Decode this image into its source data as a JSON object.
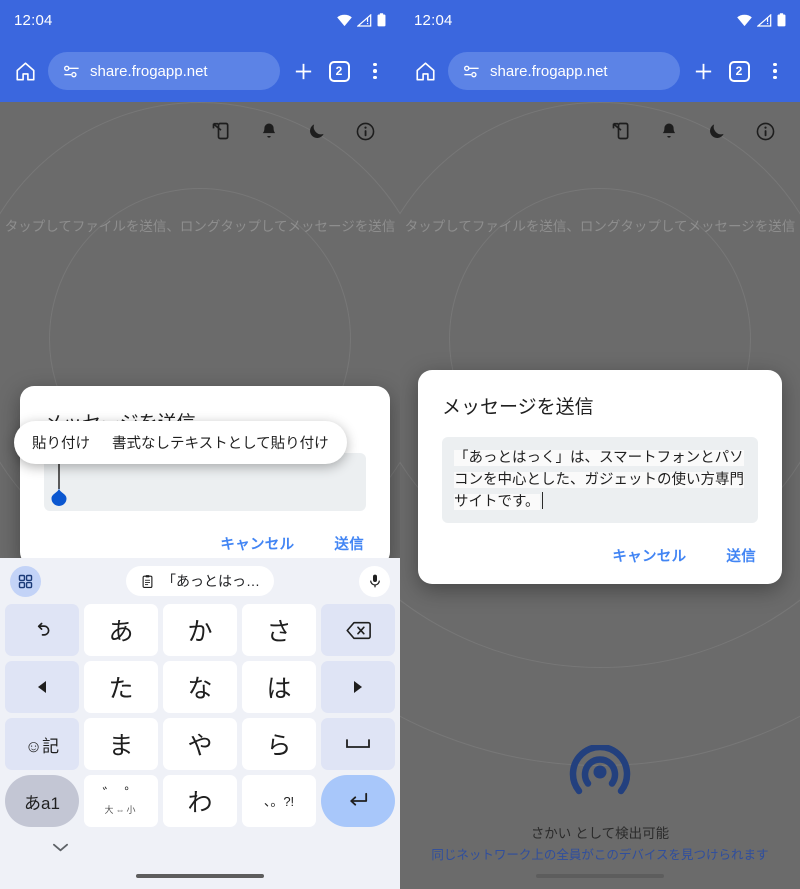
{
  "status_bar": {
    "time": "12:04",
    "icons": [
      "wifi-icon",
      "cellular-signal-icon",
      "battery-icon"
    ]
  },
  "browser": {
    "home_icon": "home-icon",
    "url": "share.frogapp.net",
    "site_info_icon": "site-settings-icon",
    "new_tab_icon": "plus-icon",
    "tab_count": "2",
    "menu_icon": "overflow-menu-icon"
  },
  "app": {
    "toolbar_icons": [
      "send-to-device-icon",
      "bell-icon",
      "dark-mode-icon",
      "info-icon"
    ],
    "hint": "タップしてファイルを送信、ロングタップしてメッセージを送信",
    "device_name": "さかい として検出可能",
    "device_sub": "同じネットワーク上の全員がこのデバイスを見つけられます",
    "radar_icon": "broadcast-icon",
    "accent_blue": "#2f4e9e"
  },
  "dialog": {
    "title": "メッセージを送信",
    "message": "「あっとはっく」は、スマートフォンとパソコンを中心とした、ガジェットの使い方専門サイトです。",
    "message_placeholder": "",
    "empty_value": "",
    "cancel_label": "キャンセル",
    "send_label": "送信",
    "accent": "#4285f4"
  },
  "paste_popup": {
    "paste_label": "貼り付け",
    "paste_plain_label": "書式なしテキストとして貼り付け"
  },
  "keyboard": {
    "grid_icon": "apps-grid-icon",
    "clipboard_icon": "clipboard-icon",
    "suggestion": "「あっとはっ…",
    "mic_icon": "microphone-icon",
    "hide_icon": "chevron-down-icon",
    "rows": [
      [
        {
          "label": "↺",
          "name": "undo-key",
          "type": "fn"
        },
        {
          "label": "あ",
          "name": "key-a",
          "type": "char"
        },
        {
          "label": "か",
          "name": "key-ka",
          "type": "char"
        },
        {
          "label": "さ",
          "name": "key-sa",
          "type": "char"
        },
        {
          "label": "⌫",
          "name": "backspace-key",
          "type": "fn"
        }
      ],
      [
        {
          "label": "◀",
          "name": "cursor-left-key",
          "type": "fn"
        },
        {
          "label": "た",
          "name": "key-ta",
          "type": "char"
        },
        {
          "label": "な",
          "name": "key-na",
          "type": "char"
        },
        {
          "label": "は",
          "name": "key-ha",
          "type": "char"
        },
        {
          "label": "▶",
          "name": "cursor-right-key",
          "type": "fn"
        }
      ],
      [
        {
          "label": "☺記",
          "name": "emoji-symbol-key",
          "type": "fn"
        },
        {
          "label": "ま",
          "name": "key-ma",
          "type": "char"
        },
        {
          "label": "や",
          "name": "key-ya",
          "type": "char"
        },
        {
          "label": "ら",
          "name": "key-ra",
          "type": "char"
        },
        {
          "label": "␣",
          "name": "space-key",
          "type": "fn"
        }
      ],
      [
        {
          "label": "あa1",
          "name": "input-mode-key",
          "type": "shift"
        },
        {
          "label": "゛゜",
          "sublabel": "大⇔小",
          "name": "dakuten-key",
          "type": "dual"
        },
        {
          "label": "わ",
          "name": "key-wa",
          "type": "char"
        },
        {
          "label": "、。?!",
          "name": "punctuation-key",
          "type": "punc"
        },
        {
          "label": "↵",
          "name": "enter-key",
          "type": "enter"
        }
      ]
    ]
  }
}
